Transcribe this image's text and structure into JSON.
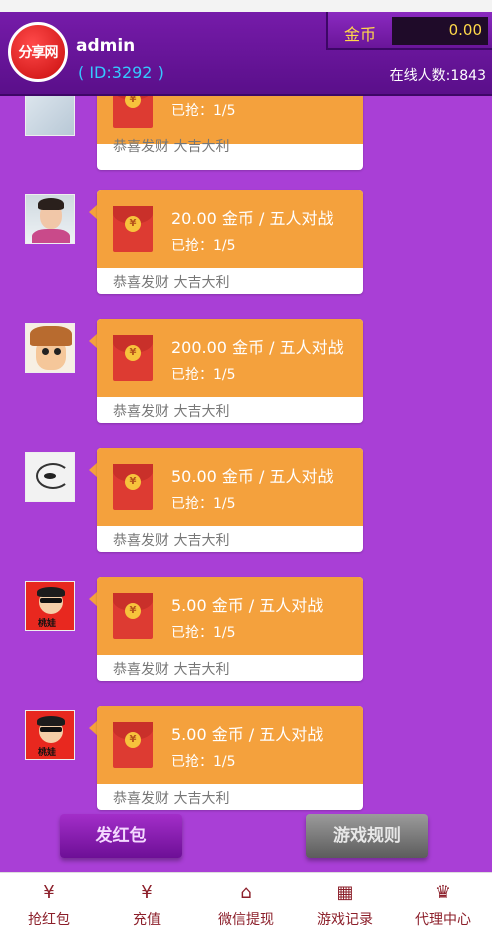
{
  "header": {
    "logo_text": "分享网",
    "username": "admin",
    "user_id": "( ID:3292 )",
    "coin_label": "金币",
    "coin_value": "0.00",
    "online": "在线人数:1843"
  },
  "messages": [
    {
      "amount": "",
      "grabbed": "已抢：1/5",
      "wish": "恭喜发财 大吉大利",
      "avatar": "av-a"
    },
    {
      "amount": "20.00 金币 / 五人对战",
      "grabbed": "已抢：1/5",
      "wish": "恭喜发财 大吉大利",
      "avatar": "av-man"
    },
    {
      "amount": "200.00 金币 / 五人对战",
      "grabbed": "已抢：1/5",
      "wish": "恭喜发财 大吉大利",
      "avatar": "av-cartoon"
    },
    {
      "amount": "50.00 金币 / 五人对战",
      "grabbed": "已抢：1/5",
      "wish": "恭喜发财 大吉大利",
      "avatar": "av-sketch"
    },
    {
      "amount": "5.00 金币 / 五人对战",
      "grabbed": "已抢：1/5",
      "wish": "恭喜发财 大吉大利",
      "avatar": "av-red"
    },
    {
      "amount": "5.00 金币 / 五人对战",
      "grabbed": "已抢：1/5",
      "wish": "恭喜发财 大吉大利",
      "avatar": "av-red"
    }
  ],
  "envelope_coin_symbol": "¥",
  "avatar_tag": "桃娃",
  "buttons": {
    "send": "发红包",
    "rules": "游戏规则"
  },
  "nav": [
    {
      "label": "抢红包",
      "icon": "money-bag-icon",
      "glyph": "¥"
    },
    {
      "label": "充值",
      "icon": "recharge-icon",
      "glyph": "¥"
    },
    {
      "label": "微信提现",
      "icon": "gift-icon",
      "glyph": "⌂"
    },
    {
      "label": "游戏记录",
      "icon": "records-icon",
      "glyph": "▦"
    },
    {
      "label": "代理中心",
      "icon": "crown-icon",
      "glyph": "♛"
    }
  ],
  "colors": {
    "background": "#a93fd6",
    "card_orange": "#f4a13d",
    "envelope_red": "#dd3b32",
    "nav_text": "#8c1f2a"
  }
}
